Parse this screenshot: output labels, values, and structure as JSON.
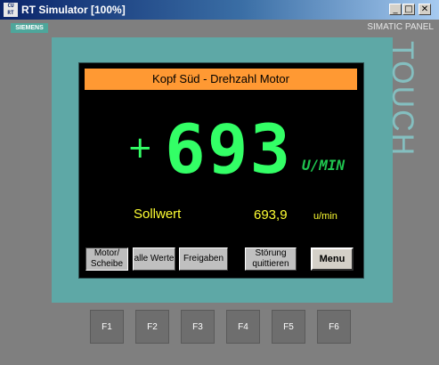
{
  "window": {
    "title": "RT Simulator [100%]",
    "icon_text": "CU\nRT",
    "minimize": "_",
    "maximize": "□",
    "close": "✕"
  },
  "panel": {
    "brand": "SIEMENS",
    "model": "SIMATIC PANEL",
    "touch": "TOUCH"
  },
  "screen": {
    "header": "Kopf Süd -  Drehzahl Motor",
    "sign": "+",
    "speed_value": "693",
    "speed_unit": "U/MIN",
    "setpoint_label": "Sollwert",
    "setpoint_value": "693,9",
    "setpoint_unit": "u/min"
  },
  "buttons": [
    {
      "label": "Motor/ Scheibe"
    },
    {
      "label": "alle Werte"
    },
    {
      "label": "Freigaben"
    },
    {
      "label": "Störung quittieren"
    },
    {
      "label": "Menu"
    }
  ],
  "fkeys": [
    "F1",
    "F2",
    "F3",
    "F4",
    "F5",
    "F6"
  ]
}
